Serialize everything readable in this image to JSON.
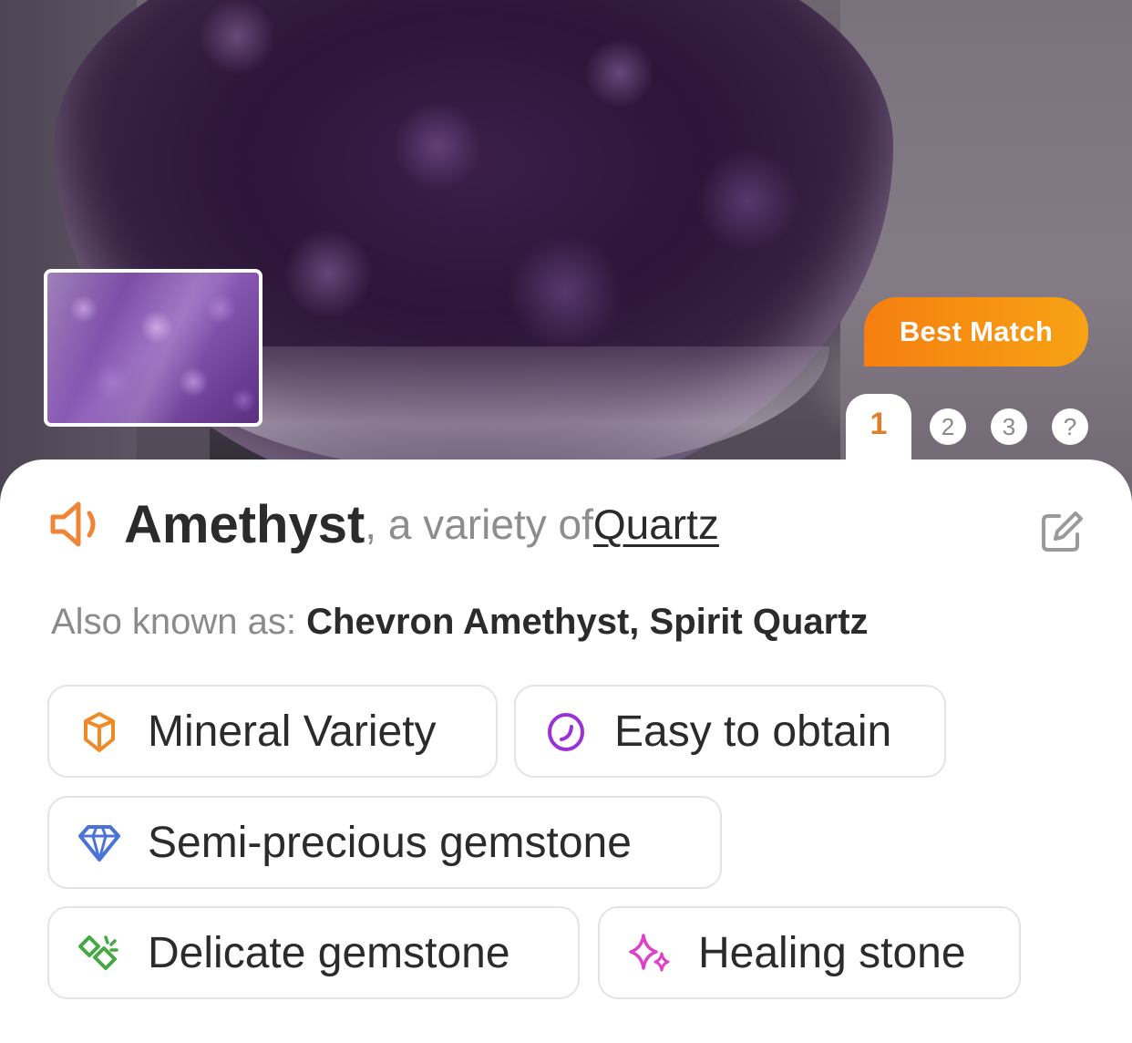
{
  "result": {
    "best_match_label": "Best Match",
    "pages": [
      "1",
      "2",
      "3",
      "?"
    ],
    "active_page": "1"
  },
  "stone": {
    "name": "Amethyst",
    "variety_text": ", a variety of ",
    "parent": "Quartz",
    "aka_label": "Also known as: ",
    "aka_values": "Chevron Amethyst, Spirit Quartz"
  },
  "tags": [
    {
      "label": "Mineral Variety",
      "icon": "crystal-icon",
      "color": "#ef8a25"
    },
    {
      "label": "Easy to obtain",
      "icon": "pebble-icon",
      "color": "#9b30d9"
    },
    {
      "label": "Semi-precious gemstone",
      "icon": "diamond-icon",
      "color": "#4a73d9"
    },
    {
      "label": "Delicate gemstone",
      "icon": "broken-gem-icon",
      "color": "#45a843"
    },
    {
      "label": "Healing stone",
      "icon": "sparkle-icon",
      "color": "#e040c8"
    }
  ],
  "colors": {
    "accent": "#f57f10",
    "text_primary": "#2b2b2b",
    "text_secondary": "#8b8b8b"
  }
}
